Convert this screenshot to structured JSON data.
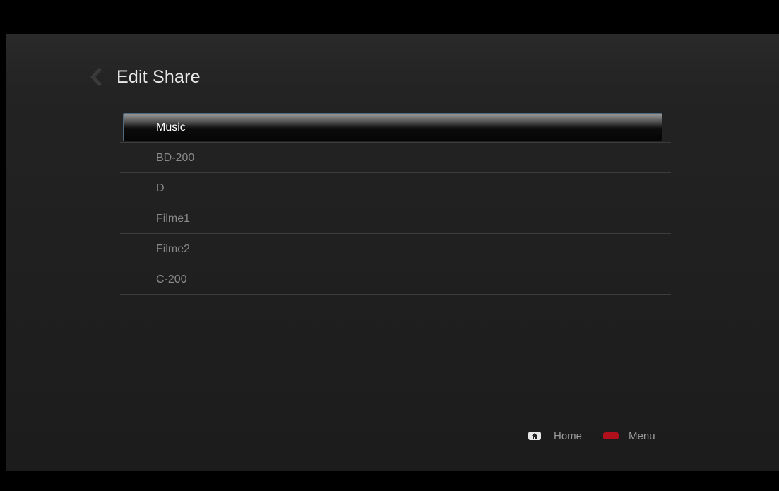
{
  "header": {
    "title": "Edit Share",
    "back_icon": "chevron-left-icon"
  },
  "shares": [
    {
      "label": "Music",
      "selected": true
    },
    {
      "label": "BD-200",
      "selected": false
    },
    {
      "label": "D",
      "selected": false
    },
    {
      "label": "Filme1",
      "selected": false
    },
    {
      "label": "Filme2",
      "selected": false
    },
    {
      "label": "C-200",
      "selected": false
    }
  ],
  "footer": {
    "home_label": "Home",
    "home_icon": "home-icon",
    "menu_label": "Menu",
    "menu_icon": "red-button-icon",
    "menu_color": "#b0101c"
  },
  "colors": {
    "background": "#1f1f1f",
    "selection_border": "#4d6a80",
    "item_text": "#8a8a8a",
    "selected_text": "#ffffff"
  }
}
